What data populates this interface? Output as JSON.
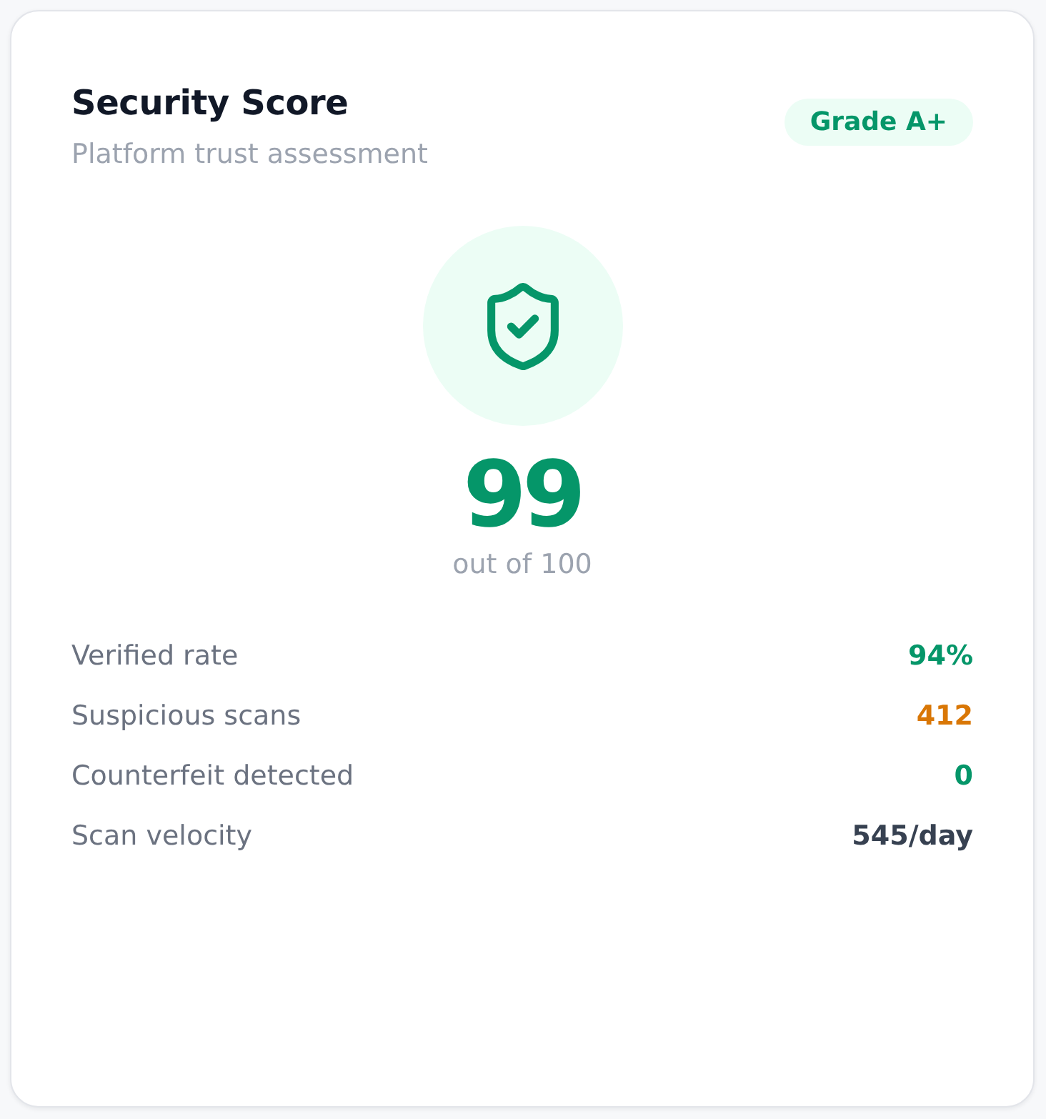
{
  "card": {
    "title": "Security Score",
    "subtitle": "Platform trust assessment",
    "badge": "Grade A+"
  },
  "score": {
    "value": "99",
    "caption": "out of 100"
  },
  "metrics": [
    {
      "label": "Verified rate",
      "value": "94%",
      "color": "#059669"
    },
    {
      "label": "Suspicious scans",
      "value": "412",
      "color": "#d97706"
    },
    {
      "label": "Counterfeit detected",
      "value": "0",
      "color": "#059669"
    },
    {
      "label": "Scan velocity",
      "value": "545/day",
      "color": "#374151"
    }
  ]
}
